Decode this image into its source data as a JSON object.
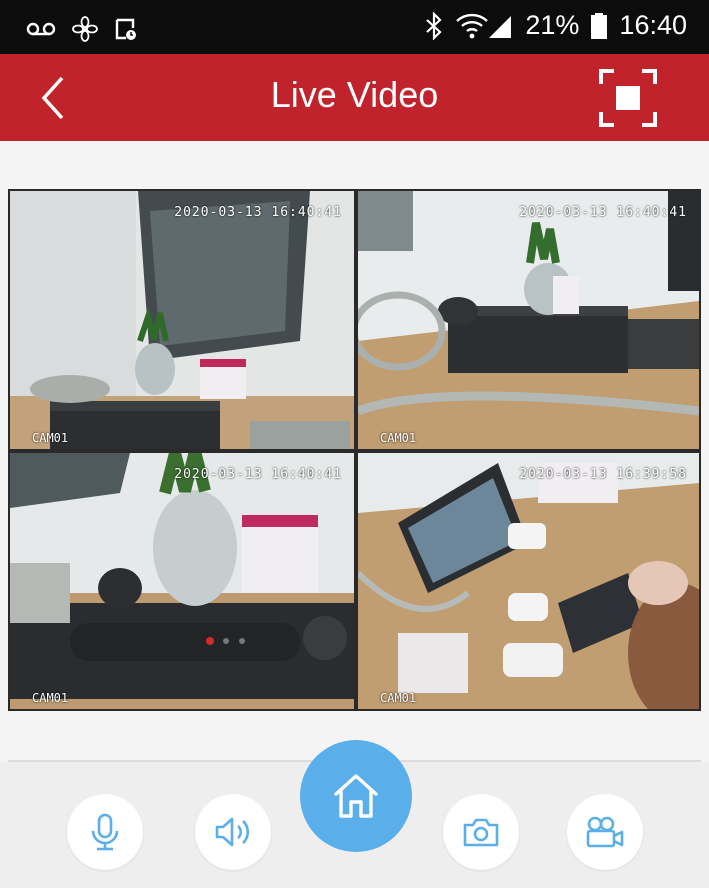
{
  "status_bar": {
    "battery_percent": "21%",
    "time": "16:40",
    "battery_level": 0.21
  },
  "header": {
    "title": "Live Video",
    "bg_color": "#c1232c",
    "icons": [
      "chevron-left-icon",
      "fullscreen-icon"
    ]
  },
  "cameras": [
    {
      "name": "CAM01",
      "timestamp": "2020-03-13 16:40:41"
    },
    {
      "name": "CAM01",
      "timestamp": "2020-03-13 16:40:41"
    },
    {
      "name": "CAM01",
      "timestamp": "2020-03-13 16:40:41"
    },
    {
      "name": "CAM01",
      "timestamp": "2020-03-13 16:39:58"
    }
  ],
  "controls": {
    "icons": [
      "microphone-icon",
      "speaker-icon",
      "home-icon",
      "camera-icon",
      "video-camera-icon"
    ],
    "accent_color": "#5aafea"
  }
}
